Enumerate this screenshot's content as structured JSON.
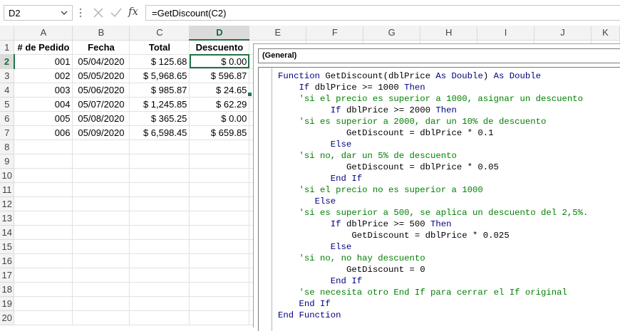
{
  "formula_bar": {
    "name_box": "D2",
    "fx_label": "fx",
    "formula": "=GetDiscount(C2)"
  },
  "grid": {
    "columns": [
      "A",
      "B",
      "C",
      "D",
      "E",
      "F",
      "G",
      "H",
      "I",
      "J",
      "K"
    ],
    "rows": [
      "1",
      "2",
      "3",
      "4",
      "5",
      "6",
      "7",
      "8",
      "9",
      "10",
      "11",
      "12",
      "13",
      "14",
      "15",
      "16",
      "17",
      "18",
      "19",
      "20"
    ],
    "active_cell": "D2",
    "headers": [
      "# de Pedido",
      "Fecha",
      "Total",
      "Descuento"
    ],
    "data": [
      {
        "pedido": "001",
        "fecha": "05/04/2020",
        "total": "$ 125.68",
        "descuento": "$ 0.00"
      },
      {
        "pedido": "002",
        "fecha": "05/05/2020",
        "total": "$ 5,968.65",
        "descuento": "$ 596.87"
      },
      {
        "pedido": "003",
        "fecha": "05/06/2020",
        "total": "$ 985.87",
        "descuento": "$ 24.65"
      },
      {
        "pedido": "004",
        "fecha": "05/07/2020",
        "total": "$ 1,245.85",
        "descuento": "$ 62.29"
      },
      {
        "pedido": "005",
        "fecha": "05/08/2020",
        "total": "$ 365.25",
        "descuento": "$ 0.00"
      },
      {
        "pedido": "006",
        "fecha": "05/09/2020",
        "total": "$ 6,598.45",
        "descuento": "$ 659.85"
      }
    ]
  },
  "code_window": {
    "object_combo": "(General)",
    "lines": [
      {
        "indent": "",
        "parts": [
          {
            "t": "kw",
            "s": "Function"
          },
          {
            "t": "tx",
            "s": " GetDiscount(dblPrice "
          },
          {
            "t": "kw",
            "s": "As Double"
          },
          {
            "t": "tx",
            "s": ") "
          },
          {
            "t": "kw",
            "s": "As Double"
          }
        ]
      },
      {
        "indent": "    ",
        "parts": [
          {
            "t": "kw",
            "s": "If"
          },
          {
            "t": "tx",
            "s": " dblPrice >= 1000 "
          },
          {
            "t": "kw",
            "s": "Then"
          }
        ]
      },
      {
        "indent": "    ",
        "parts": [
          {
            "t": "cm",
            "s": "'si el precio es superior a 1000, asignar un descuento"
          }
        ]
      },
      {
        "indent": "          ",
        "parts": [
          {
            "t": "kw",
            "s": "If"
          },
          {
            "t": "tx",
            "s": " dblPrice >= 2000 "
          },
          {
            "t": "kw",
            "s": "Then"
          }
        ]
      },
      {
        "indent": "    ",
        "parts": [
          {
            "t": "cm",
            "s": "'si es superior a 2000, dar un 10% de descuento"
          }
        ]
      },
      {
        "indent": "             ",
        "parts": [
          {
            "t": "tx",
            "s": "GetDiscount = dblPrice * 0.1"
          }
        ]
      },
      {
        "indent": "          ",
        "parts": [
          {
            "t": "kw",
            "s": "Else"
          }
        ]
      },
      {
        "indent": "    ",
        "parts": [
          {
            "t": "cm",
            "s": "'si no, dar un 5% de descuento"
          }
        ]
      },
      {
        "indent": "             ",
        "parts": [
          {
            "t": "tx",
            "s": "GetDiscount = dblPrice * 0.05"
          }
        ]
      },
      {
        "indent": "          ",
        "parts": [
          {
            "t": "kw",
            "s": "End If"
          }
        ]
      },
      {
        "indent": "    ",
        "parts": [
          {
            "t": "cm",
            "s": "'si el precio no es superior a 1000"
          }
        ]
      },
      {
        "indent": "       ",
        "parts": [
          {
            "t": "kw",
            "s": "Else"
          }
        ]
      },
      {
        "indent": "    ",
        "parts": [
          {
            "t": "cm",
            "s": "'si es superior a 500, se aplica un descuento del 2,5%."
          }
        ]
      },
      {
        "indent": "          ",
        "parts": [
          {
            "t": "kw",
            "s": "If"
          },
          {
            "t": "tx",
            "s": " dblPrice >= 500 "
          },
          {
            "t": "kw",
            "s": "Then"
          }
        ]
      },
      {
        "indent": "              ",
        "parts": [
          {
            "t": "tx",
            "s": "GetDiscount = dblPrice * 0.025"
          }
        ]
      },
      {
        "indent": "          ",
        "parts": [
          {
            "t": "kw",
            "s": "Else"
          }
        ]
      },
      {
        "indent": "    ",
        "parts": [
          {
            "t": "cm",
            "s": "'si no, no hay descuento"
          }
        ]
      },
      {
        "indent": "             ",
        "parts": [
          {
            "t": "tx",
            "s": "GetDiscount = 0"
          }
        ]
      },
      {
        "indent": "          ",
        "parts": [
          {
            "t": "kw",
            "s": "End If"
          }
        ]
      },
      {
        "indent": "    ",
        "parts": [
          {
            "t": "cm",
            "s": "'se necesita otro End If para cerrar el If original"
          }
        ]
      },
      {
        "indent": "    ",
        "parts": [
          {
            "t": "kw",
            "s": "End If"
          }
        ]
      },
      {
        "indent": "",
        "parts": [
          {
            "t": "kw",
            "s": "End Function"
          }
        ]
      }
    ]
  },
  "colors": {
    "selection_green": "#217346",
    "vba_keyword": "#00007f",
    "vba_comment": "#007f00"
  }
}
